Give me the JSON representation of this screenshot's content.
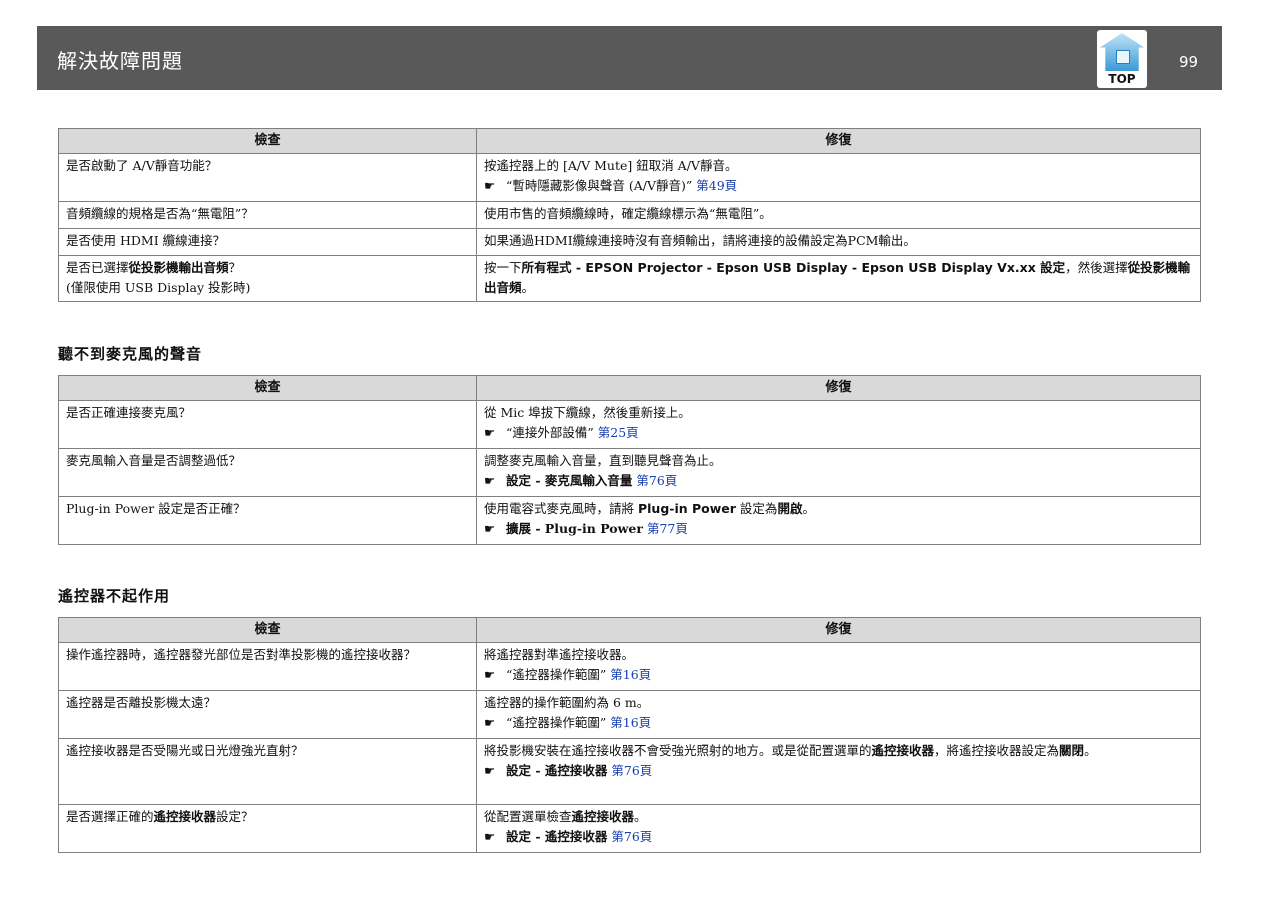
{
  "header": {
    "title": "解決故障問題",
    "top_label": "TOP",
    "page_number": "99"
  },
  "columns": {
    "check": "檢查",
    "fix": "修復"
  },
  "pointer_glyph": "☛",
  "table1": {
    "rows": [
      {
        "check": "是否啟動了 A/V靜音功能？",
        "fix_text": "按遙控器上的 [A/V Mute] 鈕取消 A/V靜音。",
        "ref_text": "“暫時隱藏影像與聲音 (A/V靜音)”",
        "ref_link": "第49頁"
      },
      {
        "check": "音頻纜線的規格是否為“無電阻”？",
        "fix_text": "使用市售的音頻纜線時，確定纜線標示為“無電阻”。"
      },
      {
        "check": "是否使用 HDMI 纜線連接？",
        "fix_text": "如果通過HDMI纜線連接時沒有音頻輸出，請將連接的設備設定為PCM輸出。"
      },
      {
        "check_a": "是否已選擇",
        "check_b": "從投影機輸出音頻",
        "check_c": "？",
        "check_note": "(僅限使用 USB Display 投影時)",
        "fix_a": "按一下",
        "fix_b": "所有程式 - EPSON Projector - Epson USB Display - Epson USB Display Vx.xx 設定",
        "fix_c": "，然後選擇",
        "fix_d": "從投影機輸出音頻",
        "fix_e": "。"
      }
    ]
  },
  "section2": {
    "title": "聽不到麥克風的聲音",
    "rows": [
      {
        "check": "是否正確連接麥克風？",
        "fix_text": "從 Mic 埠拔下纜線，然後重新接上。",
        "ref_text": "“連接外部設備”",
        "ref_link": "第25頁"
      },
      {
        "check": "麥克風輸入音量是否調整過低？",
        "fix_text": "調整麥克風輸入音量，直到聽見聲音為止。",
        "ref_text": "設定 - 麥克風輸入音量",
        "ref_link": "第76頁"
      },
      {
        "check": "Plug-in Power 設定是否正確？",
        "fix_a": "使用電容式麥克風時，請將 ",
        "fix_b": "Plug-in Power",
        "fix_c": " 設定為",
        "fix_d": "開啟",
        "fix_e": "。",
        "ref_text": "擴展 - Plug-in Power",
        "ref_link": "第77頁"
      }
    ]
  },
  "section3": {
    "title": "遙控器不起作用",
    "rows": [
      {
        "check": "操作遙控器時，遙控器發光部位是否對準投影機的遙控接收器？",
        "fix_text": "將遙控器對準遙控接收器。",
        "ref_text": "“遙控器操作範圍”",
        "ref_link": "第16頁"
      },
      {
        "check": "遙控器是否離投影機太遠？",
        "fix_text": "遙控器的操作範圍約為 6 m。",
        "ref_text": "“遙控器操作範圍”",
        "ref_link": "第16頁"
      },
      {
        "check": "遙控接收器是否受陽光或日光燈強光直射？",
        "fix_a": "將投影機安裝在遙控接收器不會受強光照射的地方。或是從配置選單的",
        "fix_b": "遙控接收器",
        "fix_c": "，將遙控接收器設定為",
        "fix_d": "關閉",
        "fix_e": "。",
        "ref_text": "設定 - 遙控接收器",
        "ref_link": "第76頁"
      },
      {
        "check_a": "是否選擇正確的",
        "check_b": "遙控接收器",
        "check_c": "設定？",
        "fix_a": "從配置選單檢查",
        "fix_b": "遙控接收器",
        "fix_c": "。",
        "ref_text": "設定 - 遙控接收器",
        "ref_link": "第76頁"
      }
    ]
  }
}
